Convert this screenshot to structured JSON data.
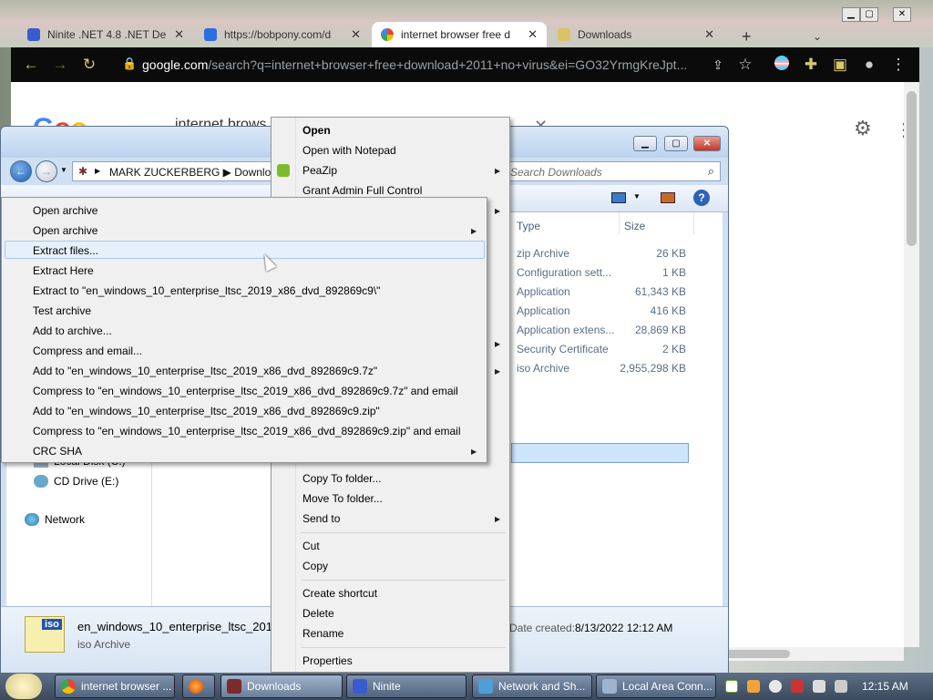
{
  "browser": {
    "tabs": [
      {
        "title": "Ninite .NET 4.8 .NET De",
        "close": "✕"
      },
      {
        "title": "https://bobpony.com/d",
        "close": "✕"
      },
      {
        "title": "internet browser free d",
        "close": "✕"
      },
      {
        "title": "Downloads",
        "close": "✕"
      }
    ],
    "new_tab": "+",
    "url_host": "google.com",
    "url_rest": "/search?q=internet+browser+free+download+2011+no+virus&ei=GO32YrmgKreJpt...",
    "search_query": "internet brows"
  },
  "explorer": {
    "breadcrumb": "MARK ZUCKERBERG  ▶  Downloa",
    "search_placeholder": "Search Downloads",
    "columns": {
      "type": "Type",
      "size": "Size"
    },
    "rows": [
      {
        "type": "zip Archive",
        "size": "26 KB"
      },
      {
        "type": "Configuration sett...",
        "size": "1 KB"
      },
      {
        "type": "Application",
        "size": "61,343 KB"
      },
      {
        "type": "Application",
        "size": "416 KB"
      },
      {
        "type": "Application extens...",
        "size": "28,869 KB"
      },
      {
        "type": "Security Certificate",
        "size": "2 KB"
      },
      {
        "type": "iso Archive",
        "size": "2,955,298 KB"
      }
    ],
    "tree": {
      "local_disk": "Local Disk (C:)",
      "cd_drive": "CD Drive (E:)",
      "network": "Network"
    },
    "details": {
      "filename": "en_windows_10_enterprise_ltsc_2019_",
      "filetype": "iso Archive",
      "date_label": "Date created:",
      "date_value": "8/13/2022 12:12 AM",
      "icon_text": "iso"
    }
  },
  "context_menu": {
    "items": {
      "open": "Open",
      "open_notepad": "Open with Notepad",
      "peazip": "PeaZip",
      "grant": "Grant Admin Full Control",
      "copy_to": "Copy To folder...",
      "move_to": "Move To folder...",
      "send_to": "Send to",
      "cut": "Cut",
      "copy": "Copy",
      "create_shortcut": "Create shortcut",
      "delete": "Delete",
      "rename": "Rename",
      "properties": "Properties"
    }
  },
  "peazip_menu": {
    "items": [
      "Open archive",
      "Open archive",
      "Extract files...",
      "Extract Here",
      "Extract to \"en_windows_10_enterprise_ltsc_2019_x86_dvd_892869c9\\\"",
      "Test archive",
      "Add to archive...",
      "Compress and email...",
      "Add to \"en_windows_10_enterprise_ltsc_2019_x86_dvd_892869c9.7z\"",
      "Compress to \"en_windows_10_enterprise_ltsc_2019_x86_dvd_892869c9.7z\" and email",
      "Add to \"en_windows_10_enterprise_ltsc_2019_x86_dvd_892869c9.zip\"",
      "Compress to \"en_windows_10_enterprise_ltsc_2019_x86_dvd_892869c9.zip\" and email",
      "CRC SHA"
    ]
  },
  "taskbar": {
    "buttons": [
      "internet browser ...",
      "Downloads",
      "Ninite",
      "Network and Sh...",
      "Local Area Conn..."
    ],
    "clock": "12:15 AM"
  },
  "colors": {
    "chrome_toolbar": "#0b0b0b",
    "explorer_frame": "#cfe0f4",
    "menu_bg": "#f0f0f0",
    "hover": "#e5f0fb"
  }
}
